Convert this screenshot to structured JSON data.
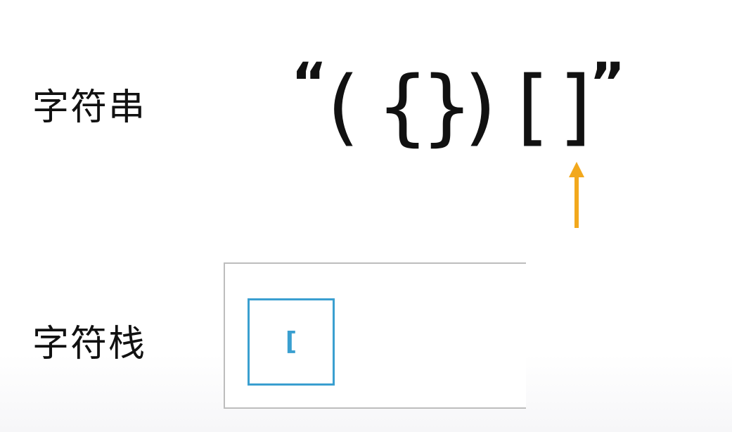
{
  "labels": {
    "string": "字符串",
    "stack": "字符栈"
  },
  "string_chars": {
    "open_quote": "“",
    "c1": "(",
    "c2": "{",
    "c3": "}",
    "c4": ")",
    "c5": "[",
    "c6": "]",
    "close_quote": "”"
  },
  "pointer": {
    "color": "#f2a81d",
    "points_to_index": 5
  },
  "stack": {
    "items": [
      "["
    ],
    "border_color": "#bdbdbd",
    "item_color": "#3a9fd0"
  }
}
